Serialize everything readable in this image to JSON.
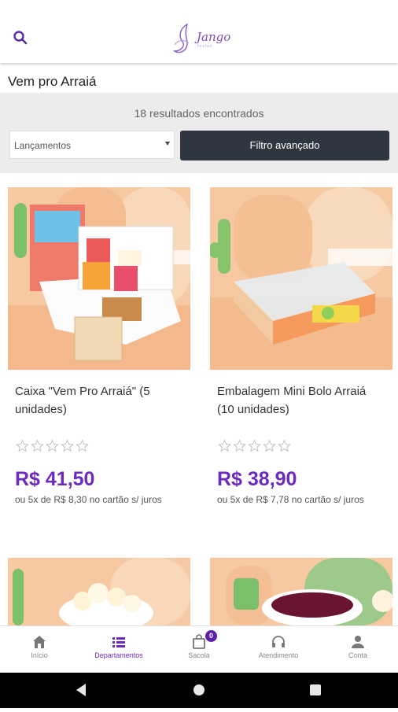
{
  "header": {
    "logo_name": "Jango",
    "logo_sub": "festas"
  },
  "page": {
    "title": "Vem pro Arraiá"
  },
  "filters": {
    "results_text": "18 resultados encontrados",
    "sort_selected": "Lançamentos",
    "filter_button_label": "Filtro avançado"
  },
  "products": [
    {
      "name": "Caixa \"Vem Pro Arraiá\" (5 unidades)",
      "rating": 0,
      "price": "R$ 41,50",
      "installments": "ou 5x de R$ 8,30 no cartão s/ juros"
    },
    {
      "name": "Embalagem Mini Bolo Arraiá (10 unidades)",
      "rating": 0,
      "price": "R$ 38,90",
      "installments": "ou 5x de R$ 7,78 no cartão s/ juros"
    }
  ],
  "bottom_nav": {
    "items": [
      {
        "label": "Início",
        "icon": "home-icon"
      },
      {
        "label": "Departamentos",
        "icon": "list-icon",
        "active": true
      },
      {
        "label": "Sacola",
        "icon": "bag-icon",
        "badge": "0"
      },
      {
        "label": "Atendimento",
        "icon": "headset-icon"
      },
      {
        "label": "Conta",
        "icon": "person-icon"
      }
    ]
  },
  "colors": {
    "accent": "#6b2bbd",
    "filter_button": "#2f3640",
    "badge": "#5b1fa8"
  }
}
